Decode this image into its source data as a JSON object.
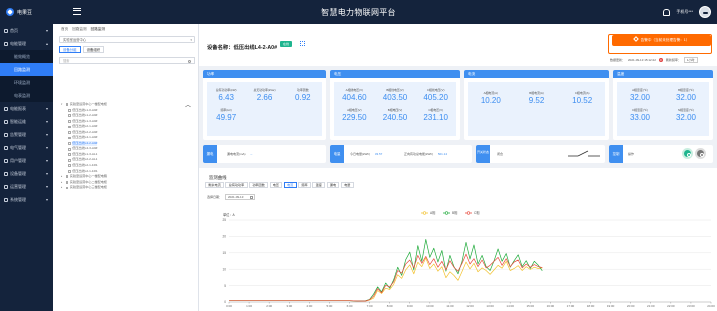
{
  "app": {
    "logo_text": "电果豆",
    "title": "智慧电力物联网平台",
    "user_label": "手机号***",
    "colors": {
      "topbar": "#14233c",
      "accent": "#2f7df6",
      "alarm": "#ff6a00",
      "card_head": "#3f8ff0",
      "online": "#1fb58f"
    }
  },
  "sidebar": {
    "items": [
      {
        "label": "首页",
        "icon": "home-icon",
        "chevron": "▾"
      },
      {
        "label": "电能管理",
        "icon": "power-icon",
        "chevron": "▴"
      },
      {
        "sub": true,
        "label": "能效概览"
      },
      {
        "sub": true,
        "label": "回路监测",
        "active": true
      },
      {
        "sub": true,
        "label": "环境监测"
      },
      {
        "sub": true,
        "label": "电表监测"
      },
      {
        "label": "电能报表",
        "icon": "report-icon",
        "chevron": "▾"
      },
      {
        "label": "智能运维",
        "icon": "maintenance-icon",
        "chevron": "▾"
      },
      {
        "label": "告警管理",
        "icon": "alarm-icon",
        "chevron": "▾"
      },
      {
        "label": "电气管理",
        "icon": "electric-icon",
        "chevron": "▾"
      },
      {
        "label": "用户管理",
        "icon": "user-icon",
        "chevron": "▾"
      },
      {
        "label": "设备管理",
        "icon": "device-icon",
        "chevron": "▾"
      },
      {
        "label": "运营管理",
        "icon": "operation-icon",
        "chevron": "▾"
      },
      {
        "label": "系统管理",
        "icon": "system-icon",
        "chevron": "▾"
      }
    ]
  },
  "tree": {
    "breadcrumbs": [
      "首页",
      "回路监测",
      "回路监测"
    ],
    "project_select": "实验室运营中心",
    "tabs": [
      "设备分组",
      "设备组织"
    ],
    "search_placeholder": "搜索",
    "nodes": [
      {
        "level": 1,
        "arrow": "▾",
        "label": "实验室运营中心一楼配电柜"
      },
      {
        "level": 2,
        "label": "低压出线L1-0-A0#"
      },
      {
        "level": 2,
        "label": "低压出线L1-2-A0#"
      },
      {
        "level": 2,
        "label": "低压出线L1-3-A0#"
      },
      {
        "level": 2,
        "label": "低压出线L2-1-A0#"
      },
      {
        "level": 2,
        "label": "低压出线L2-2-A0#"
      },
      {
        "level": 2,
        "label": "低压出线L4-1-A0#"
      },
      {
        "level": 2,
        "label": "低压出线L4-2-A0#",
        "selected": true
      },
      {
        "level": 2,
        "label": "低压出线L4-3-A0#"
      },
      {
        "level": 2,
        "label": "低压出线L1-3-AL1"
      },
      {
        "level": 2,
        "label": "低压出线L2-2-AL1"
      },
      {
        "level": 2,
        "label": "低压出线L2-1-1R1"
      },
      {
        "level": 2,
        "label": "低压出线L2-1-1R1"
      },
      {
        "level": 1,
        "arrow": "▸",
        "label": "实验室运营中心一楼配电箱"
      },
      {
        "level": 1,
        "arrow": "▸",
        "label": "实验室运营中心二楼配电柜"
      },
      {
        "level": 1,
        "arrow": "▸",
        "label": "实验室运营中心三楼配电柜"
      }
    ]
  },
  "header": {
    "device_label": "设备名称：低压出线L4-2-A0#",
    "online_badge": "在线",
    "alarm_text": "告警中（当前未处理告警：1）",
    "update_label": "数据更新：",
    "update_time": "2021-09-13 15:12:22",
    "alarm_count": "0",
    "interval_label": "刷新频率：",
    "interval_value": "1小时"
  },
  "cards": {
    "power": {
      "title": "功率",
      "metrics": [
        {
          "label": "总有功功率(kW)",
          "value": "6.43"
        },
        {
          "label": "总无功功率(kVar)",
          "value": "2.66"
        },
        {
          "label": "功率因数",
          "value": "0.92"
        },
        {
          "label": "频率(Hz)",
          "value": "49.97"
        }
      ]
    },
    "voltage": {
      "title": "电压",
      "metrics": [
        {
          "label": "A相线电压(V)",
          "value": "404.60"
        },
        {
          "label": "B相线电压(V)",
          "value": "403.50"
        },
        {
          "label": "C相线电压(V)",
          "value": "405.20"
        },
        {
          "label": "A相电压(V)",
          "value": "229.50"
        },
        {
          "label": "B相电压(V)",
          "value": "240.50"
        },
        {
          "label": "C相电压(V)",
          "value": "231.10"
        }
      ]
    },
    "current": {
      "title": "电流",
      "metrics": [
        {
          "label": "A相电流(A)",
          "value": "10.20"
        },
        {
          "label": "B相电流(A)",
          "value": "9.52"
        },
        {
          "label": "C相电流(A)",
          "value": "10.52"
        }
      ]
    },
    "temperature": {
      "title": "温度",
      "metrics": [
        {
          "label": "A相温度(℃)",
          "value": "32.00"
        },
        {
          "label": "B相温度(℃)",
          "value": "32.00"
        },
        {
          "label": "C相温度(℃)",
          "value": "33.00"
        },
        {
          "label": "N相温度(℃)",
          "value": "32.00"
        }
      ]
    }
  },
  "status": {
    "leakage": {
      "tag": "漏电",
      "label": "漏电电流(mA)",
      "value": "--"
    },
    "energy": {
      "tag": "电量",
      "today_label": "今日电量(kWh)",
      "today_value": "33.57",
      "total_label": "正向有功总电能(kWh)",
      "total_value": "501.14"
    },
    "switch": {
      "tag": "开关状态",
      "value": "闭合"
    },
    "control": {
      "tag": "控制",
      "label": "操作"
    }
  },
  "chart_panel": {
    "title": "监测曲线",
    "tabs": [
      "剩余电流",
      "总有功功率",
      "功率因数",
      "电压",
      "电流",
      "频率",
      "温度",
      "漏电",
      "电量"
    ],
    "active_tab": "电流",
    "date_label": "选择日期：",
    "date_value": "2021-09-13"
  },
  "chart_data": {
    "type": "line",
    "ylabel": "单位：A",
    "ylim": [
      0,
      25
    ],
    "yticks": [
      0,
      5,
      10,
      15,
      20,
      25
    ],
    "xticks": [
      "0:00",
      "1:00",
      "2:00",
      "3:00",
      "4:00",
      "5:00",
      "6:00",
      "7:00",
      "8:00",
      "9:00",
      "10:00",
      "11:00",
      "12:00",
      "13:00",
      "14:00",
      "15:00",
      "16:00",
      "17:00",
      "18:00",
      "19:00",
      "20:00",
      "21:00",
      "22:00",
      "23:00",
      "24:00"
    ],
    "grid": true,
    "legend": "top-center",
    "series": [
      {
        "name": "A相",
        "color": "#f2c12e",
        "x": [
          0,
          1,
          2,
          3,
          4,
          5,
          6,
          6.4,
          6.8,
          7,
          7.2,
          7.4,
          7.6,
          7.8,
          8,
          8.2,
          8.4,
          8.6,
          8.8,
          9,
          9.2,
          9.4,
          9.6,
          9.8,
          10,
          10.2,
          10.4,
          10.6,
          10.8,
          11,
          11.2,
          11.4,
          11.6,
          11.8,
          12,
          12.2,
          12.4,
          12.6,
          12.8,
          13,
          13.2,
          13.4,
          13.6,
          13.8,
          14,
          14.2,
          14.4,
          14.6,
          14.8,
          15,
          15.2,
          15.4,
          15.6
        ],
        "y": [
          0.4,
          0.4,
          0.4,
          0.4,
          0.4,
          0.4,
          0.4,
          0.3,
          0.3,
          0.6,
          1.2,
          3.5,
          2.6,
          4.2,
          3.8,
          5.4,
          8.3,
          7.2,
          9.8,
          11.3,
          8.6,
          12.1,
          10.8,
          13.4,
          10.2,
          11.6,
          9.4,
          10.8,
          7.4,
          9.2,
          8.1,
          6.6,
          9.3,
          12.2,
          10.1,
          11.8,
          9.2,
          10.4,
          9.6,
          8.4,
          9.8,
          11.2,
          10.3,
          12.4,
          9.6,
          10.2,
          11.1,
          9.6,
          10.8,
          9.9,
          10.6,
          10.2,
          10.4
        ]
      },
      {
        "name": "B相",
        "color": "#1faa3a",
        "x": [
          0,
          1,
          2,
          3,
          4,
          5,
          6,
          6.4,
          6.8,
          7,
          7.2,
          7.4,
          7.6,
          7.8,
          8,
          8.2,
          8.4,
          8.6,
          8.8,
          9,
          9.2,
          9.4,
          9.6,
          9.8,
          10,
          10.2,
          10.4,
          10.6,
          10.8,
          11,
          11.2,
          11.4,
          11.6,
          11.8,
          12,
          12.2,
          12.4,
          12.6,
          12.8,
          13,
          13.2,
          13.4,
          13.6,
          13.8,
          14,
          14.2,
          14.4,
          14.6,
          14.8,
          15,
          15.2,
          15.4,
          15.6
        ],
        "y": [
          0.4,
          0.4,
          0.4,
          0.4,
          0.4,
          0.4,
          0.4,
          0.3,
          0.4,
          0.8,
          2.4,
          4.6,
          3.1,
          5.8,
          4.2,
          6.8,
          10.6,
          8.1,
          12.9,
          15.2,
          9.8,
          17.2,
          12.4,
          19.1,
          13.6,
          16.4,
          12.2,
          15.7,
          9.4,
          14.2,
          10.8,
          8.6,
          12.4,
          18.2,
          13.1,
          17.4,
          11.6,
          14.2,
          10.8,
          9.6,
          12.6,
          16.2,
          12.4,
          14.8,
          10.6,
          12.6,
          14.4,
          10.8,
          12.6,
          10.2,
          12.4,
          11.2,
          9.5
        ]
      },
      {
        "name": "C相",
        "color": "#e84a3c",
        "x": [
          0,
          1,
          2,
          3,
          4,
          5,
          6,
          6.4,
          6.8,
          7,
          7.2,
          7.4,
          7.6,
          7.8,
          8,
          8.2,
          8.4,
          8.6,
          8.8,
          9,
          9.2,
          9.4,
          9.6,
          9.8,
          10,
          10.2,
          10.4,
          10.6,
          10.8,
          11,
          11.2,
          11.4,
          11.6,
          11.8,
          12,
          12.2,
          12.4,
          12.6,
          12.8,
          13,
          13.2,
          13.4,
          13.6,
          13.8,
          14,
          14.2,
          14.4,
          14.6,
          14.8,
          15,
          15.2,
          15.4,
          15.6
        ],
        "y": [
          0.4,
          0.4,
          0.4,
          0.4,
          0.4,
          0.4,
          0.4,
          0.3,
          0.3,
          0.7,
          1.8,
          4.1,
          2.8,
          5.1,
          4.6,
          6.2,
          9.6,
          8.8,
          11.6,
          12.8,
          10.4,
          14.2,
          11.8,
          13.9,
          11.4,
          13.2,
          10.6,
          12.4,
          9.8,
          12.6,
          10.6,
          9.4,
          11.8,
          14.6,
          11.6,
          13.2,
          10.8,
          12.8,
          10.4,
          11.2,
          12.4,
          13.6,
          11.2,
          13.2,
          10.8,
          12.2,
          12.8,
          10.4,
          11.6,
          10.6,
          11.4,
          10.8,
          10.5
        ]
      }
    ]
  }
}
